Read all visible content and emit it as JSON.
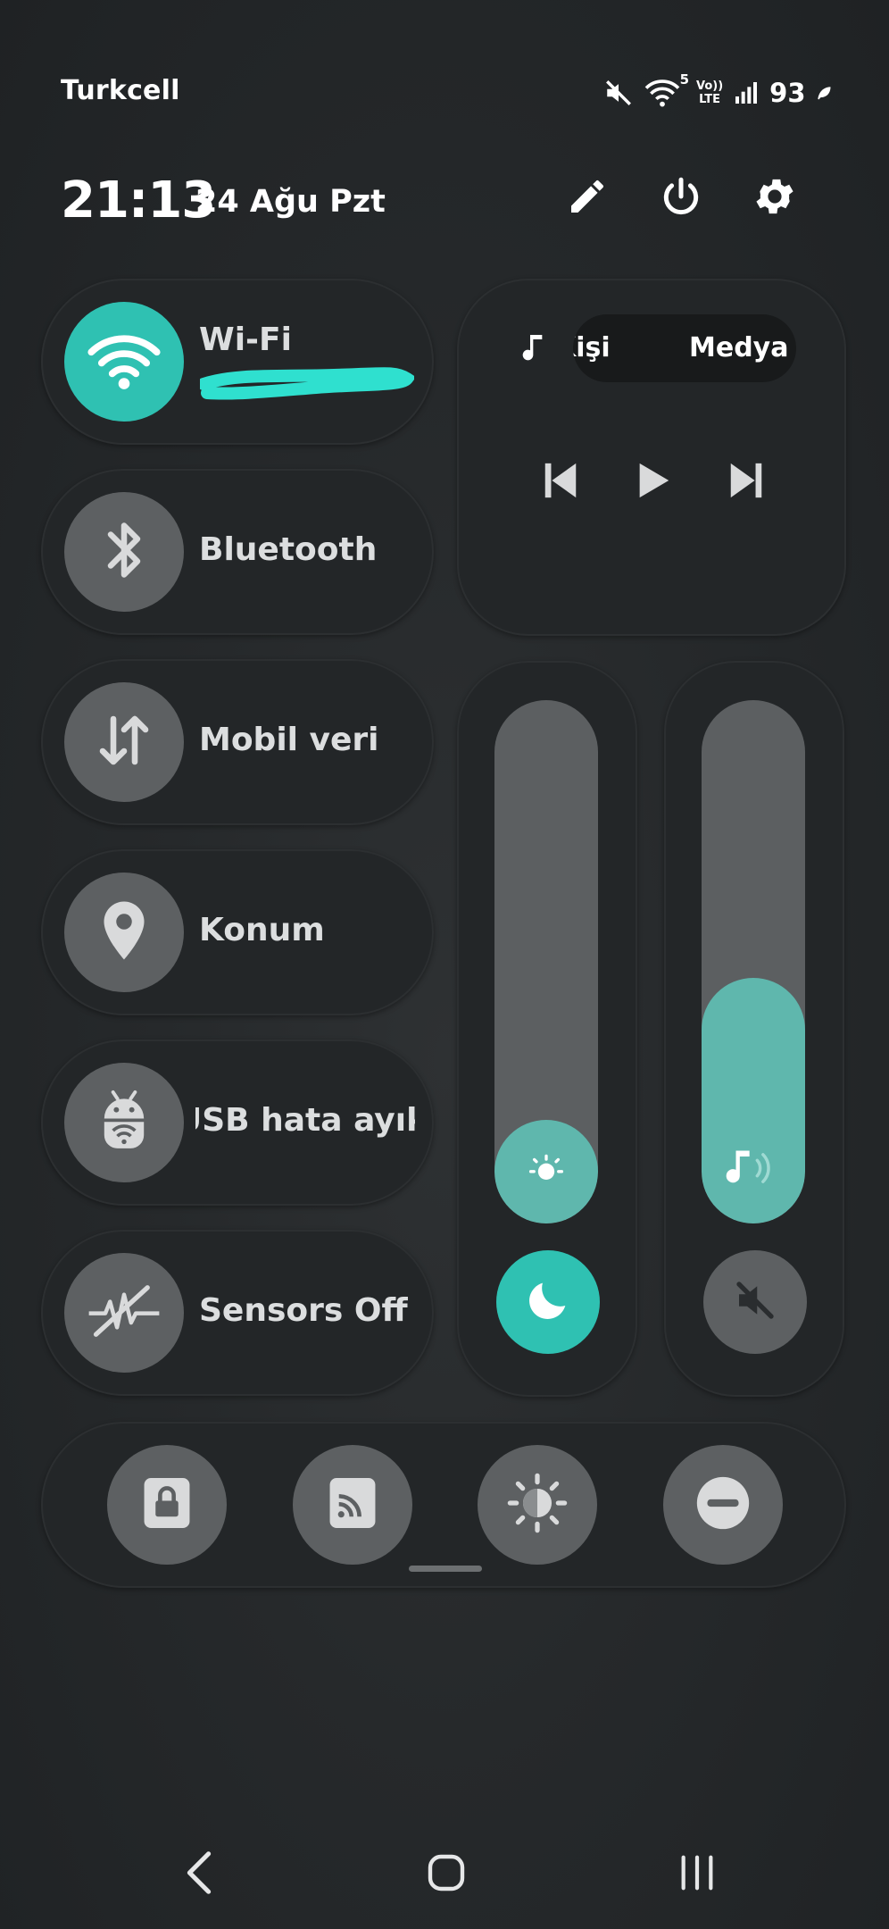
{
  "status_bar": {
    "carrier": "Turkcell",
    "wifi_badge": "5",
    "volte_label_top": "Vo))",
    "volte_label_bottom": "LTE",
    "battery": "93",
    "icons": [
      "mute-icon",
      "wifi-signal-icon",
      "volte-icon",
      "cell-signal-icon",
      "battery-saver-icon"
    ]
  },
  "header": {
    "time": "21:13",
    "date": "24 Ağu Pzt",
    "icons": [
      "pencil-icon",
      "power-icon",
      "gear-icon"
    ]
  },
  "tiles": [
    {
      "label": "Wi-Fi",
      "active": true,
      "icon": "wifi-icon"
    },
    {
      "label": "Bluetooth",
      "active": false,
      "icon": "bluetooth-icon"
    },
    {
      "label": "Mobil veri",
      "active": false,
      "icon": "mobile-data-icon"
    },
    {
      "label": "Konum",
      "active": false,
      "icon": "location-pin-icon"
    },
    {
      "label": "USB hata ayıklama",
      "active": false,
      "icon": "android-debug-icon"
    },
    {
      "label": "Sensors Off",
      "active": false,
      "icon": "sensors-off-icon"
    }
  ],
  "media": {
    "output_options": [
      "Kişi",
      "Medya"
    ],
    "controls": [
      "previous-icon",
      "play-icon",
      "next-icon"
    ]
  },
  "sliders": {
    "brightness_level": 0.1,
    "volume_level": 0.47,
    "brightness_icon": "brightness-icon",
    "volume_icon": "music-volume-icon",
    "night_mode_icon": "moon-icon",
    "mute_icon": "speaker-muted-icon"
  },
  "bottom_tiles": [
    "screen-lock-icon",
    "cast-icon",
    "auto-brightness-icon",
    "do-not-disturb-icon"
  ],
  "colors": {
    "accent": "#2fc1b2",
    "slider_fill": "#5fb7ad",
    "tile_bg": "#232628",
    "circle_bg": "#5d6062"
  }
}
